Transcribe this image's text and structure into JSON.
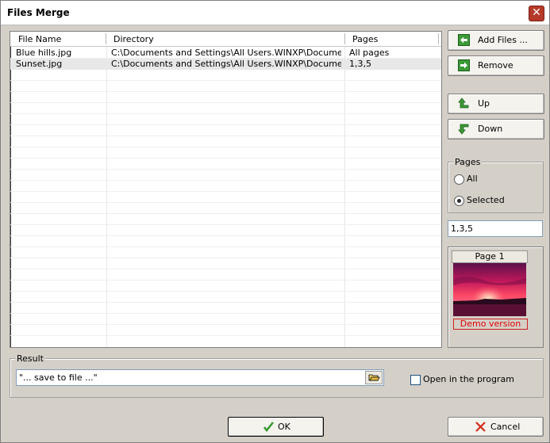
{
  "window": {
    "title": "Files Merge",
    "close_glyph": "✕"
  },
  "list": {
    "columns": [
      "File Name",
      "Directory",
      "Pages"
    ],
    "rows": [
      {
        "file": "Blue hills.jpg",
        "dir": "C:\\Documents and Settings\\All Users.WINXP\\Documents...",
        "pages": "All pages"
      },
      {
        "file": "Sunset.jpg",
        "dir": "C:\\Documents and Settings\\All Users.WINXP\\Documents...",
        "pages": "1,3,5"
      }
    ]
  },
  "buttons": {
    "add_files": "Add Files ...",
    "remove": "Remove",
    "up": "Up",
    "down": "Down",
    "ok": "OK",
    "cancel": "Cancel"
  },
  "pages_group": {
    "title": "Pages",
    "all": "All",
    "selected": "Selected",
    "selected_checked": true,
    "value": "1,3,5"
  },
  "preview": {
    "label": "Page 1",
    "demo": "Demo version"
  },
  "result": {
    "title": "Result",
    "path": "\"... save to file ...\"",
    "open_label": "Open in the program",
    "open_checked": false
  },
  "colors": {
    "accent_green": "#3a9a35",
    "demo_red": "#e00000",
    "cancel_red": "#d22a1a"
  },
  "icons": {
    "close": "close-icon",
    "add": "arrow-left-icon",
    "remove": "arrow-right-icon",
    "up": "arrow-up-icon",
    "down": "arrow-down-icon",
    "folder": "folder-open-icon",
    "ok": "checkmark-icon",
    "cancel": "x-icon"
  }
}
